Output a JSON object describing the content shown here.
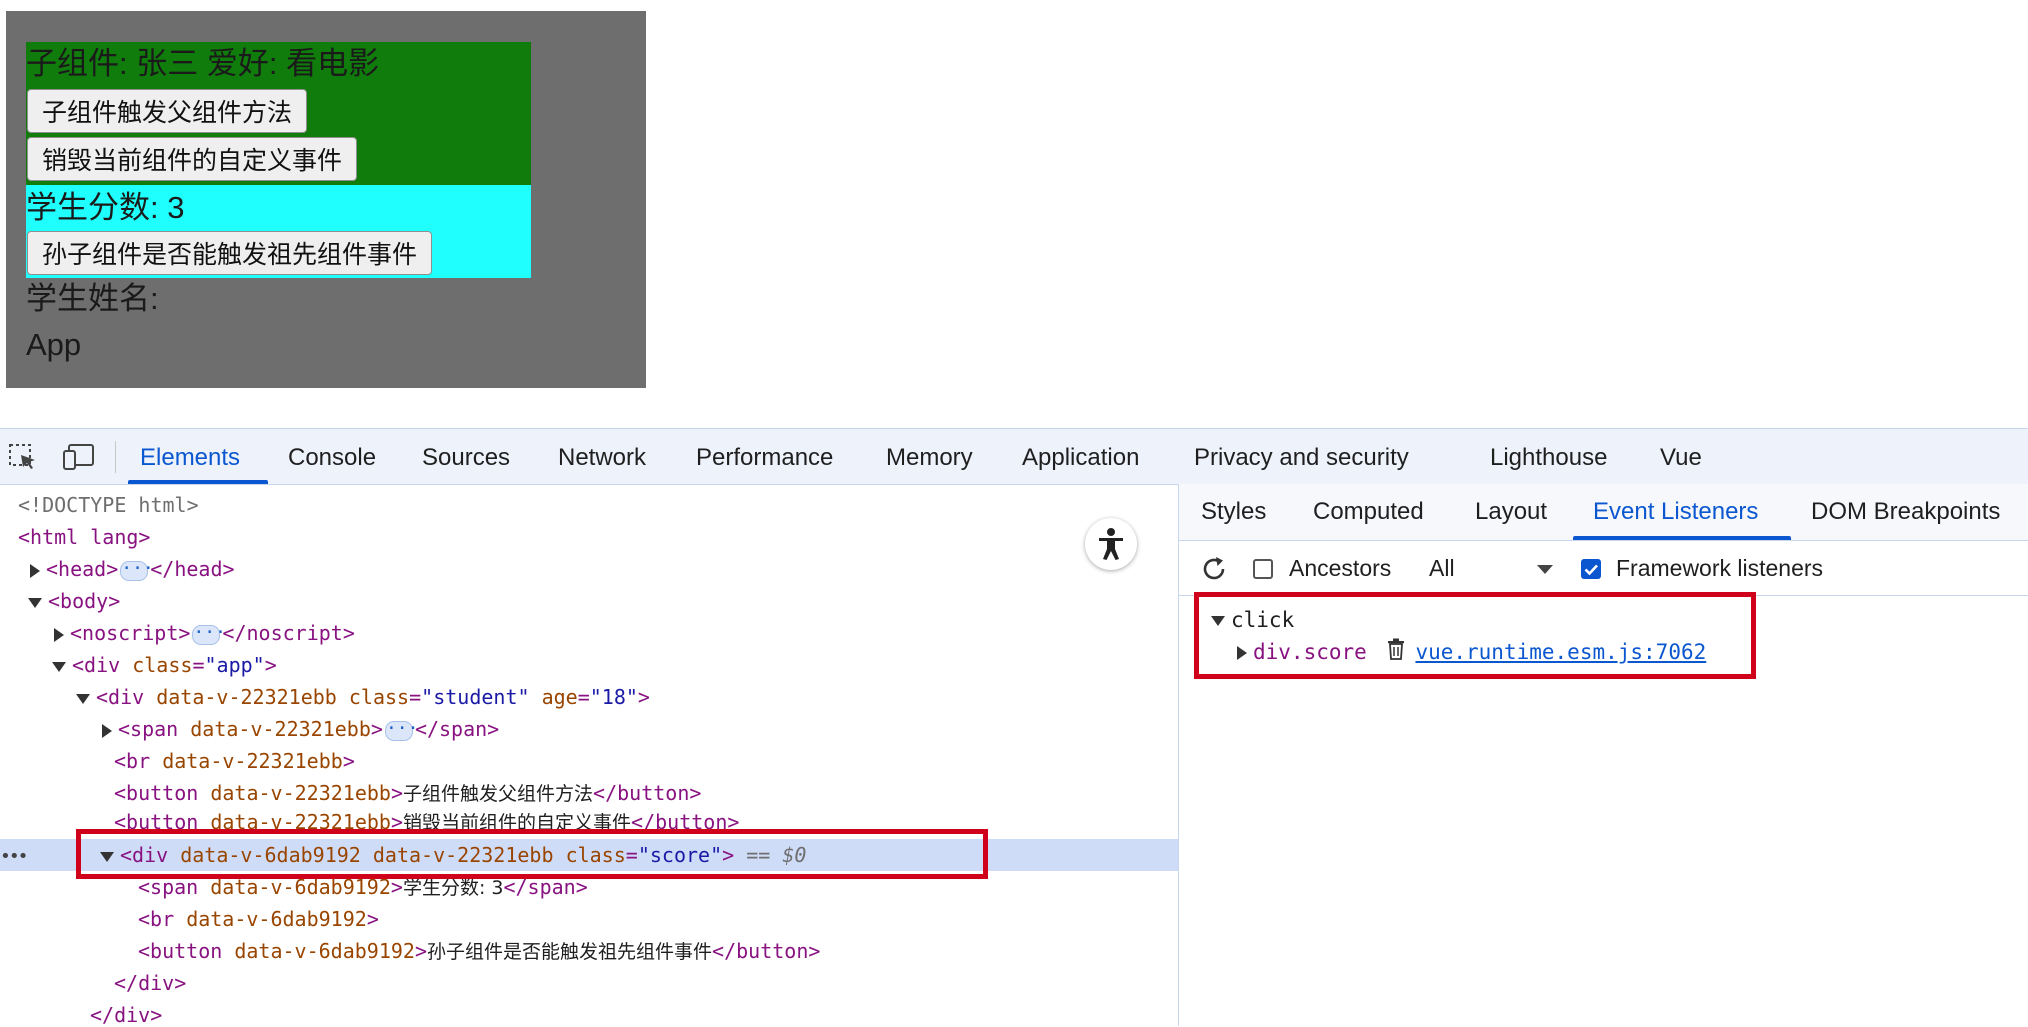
{
  "app": {
    "student_line": "子组件: 张三 爱好: 看电影",
    "btn_trigger_parent": "子组件触发父组件方法",
    "btn_destroy_events": "销毁当前组件的自定义事件",
    "score_line": "学生分数: 3",
    "btn_grandchild": "孙子组件是否能触发祖先组件事件",
    "name_line": "学生姓名:",
    "app_label": "App"
  },
  "devtools": {
    "tabs": [
      "Elements",
      "Console",
      "Sources",
      "Network",
      "Performance",
      "Memory",
      "Application",
      "Privacy and security",
      "Lighthouse",
      "Vue"
    ],
    "active_tab": "Elements",
    "dom": {
      "doctype": "<!DOCTYPE html>",
      "html_open": "<html lang>",
      "head_open": "<head>",
      "head_close": "</head>",
      "body_open": "<body>",
      "noscript_open": "<noscript>",
      "noscript_close": "</noscript>",
      "div_app_tag": "div",
      "attr_class": "class",
      "val_app": "\"app\"",
      "div_student_attr": "data-v-22321ebb",
      "val_student": "\"student\"",
      "attr_age": "age",
      "val_age": "\"18\"",
      "span_tag": "span",
      "span_close": "</span>",
      "br_tag": "br",
      "button_tag": "button",
      "button_close": "</button>",
      "button_text_1": "子组件触发父组件方法",
      "button_text_2": "销毁当前组件的自定义事件",
      "score_attr_1": "data-v-6dab9192",
      "score_attr_2": "data-v-22321ebb",
      "val_score": "\"score\"",
      "selected_marker": "== $0",
      "score_span_text": "学生分数: 3",
      "grandchild_btn_text": "孙子组件是否能触发祖先组件事件",
      "div_close": "</div>",
      "row_ellipsis": "•••"
    },
    "sidebar": {
      "tabs": [
        "Styles",
        "Computed",
        "Layout",
        "Event Listeners",
        "DOM Breakpoints"
      ],
      "active_tab": "Event Listeners",
      "ancestors_label": "Ancestors",
      "ancestors_checked": false,
      "filter_value": "All",
      "framework_label": "Framework listeners",
      "framework_checked": true,
      "event_name": "click",
      "listener_target": "div.score",
      "listener_source": "vue.runtime.esm.js:7062"
    }
  },
  "colors": {
    "student_bg": "#107c0c",
    "score_bg": "#1ffffd",
    "app_bg": "#6e6e6e",
    "highlight_red": "#d0021b",
    "accent_blue": "#0b57d0"
  }
}
